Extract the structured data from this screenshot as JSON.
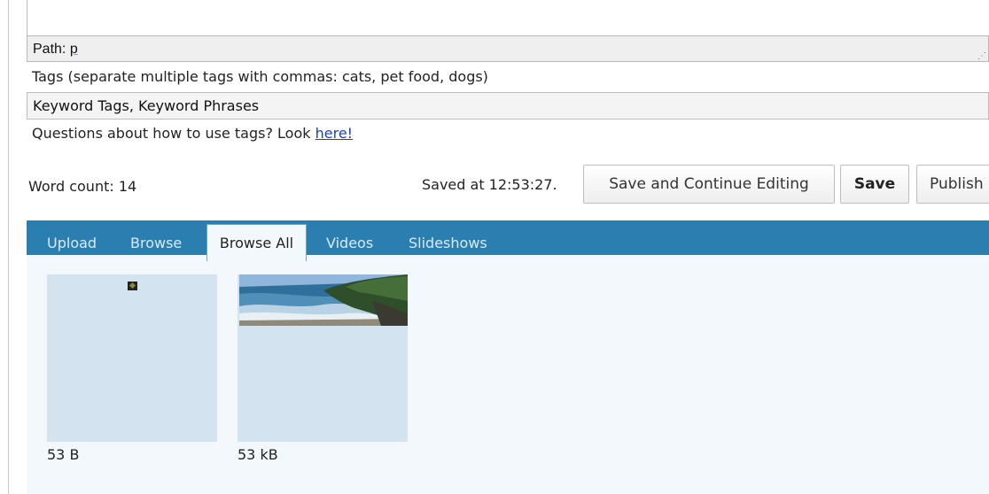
{
  "path_bar": {
    "label": "Path:",
    "value": "p",
    "grip": "⋰"
  },
  "tags": {
    "label": "Tags (separate multiple tags with commas: cats, pet food, dogs)",
    "value": "Keyword Tags, Keyword Phrases",
    "help_text": "Questions about how to use tags? Look",
    "help_link": "here!"
  },
  "status": {
    "word_count": "Word count: 14",
    "saved_at": "Saved at 12:53:27."
  },
  "buttons": {
    "save_continue": "Save and Continue Editing",
    "save": "Save",
    "publish": "Publish"
  },
  "media_tabs": [
    {
      "label": "Upload",
      "active": false
    },
    {
      "label": "Browse",
      "active": false
    },
    {
      "label": "Browse All",
      "active": true
    },
    {
      "label": "Videos",
      "active": false
    },
    {
      "label": "Slideshows",
      "active": false
    }
  ],
  "media_items": [
    {
      "size": "53 B",
      "icon": "broken-image-icon"
    },
    {
      "size": "53 kB",
      "icon": "beach-photo"
    }
  ],
  "colors": {
    "tab_bar": "#2a7fb0",
    "panel_bg": "#f3f8fc",
    "thumb_bg": "#d3e3f0",
    "link": "#1b3fc7"
  }
}
